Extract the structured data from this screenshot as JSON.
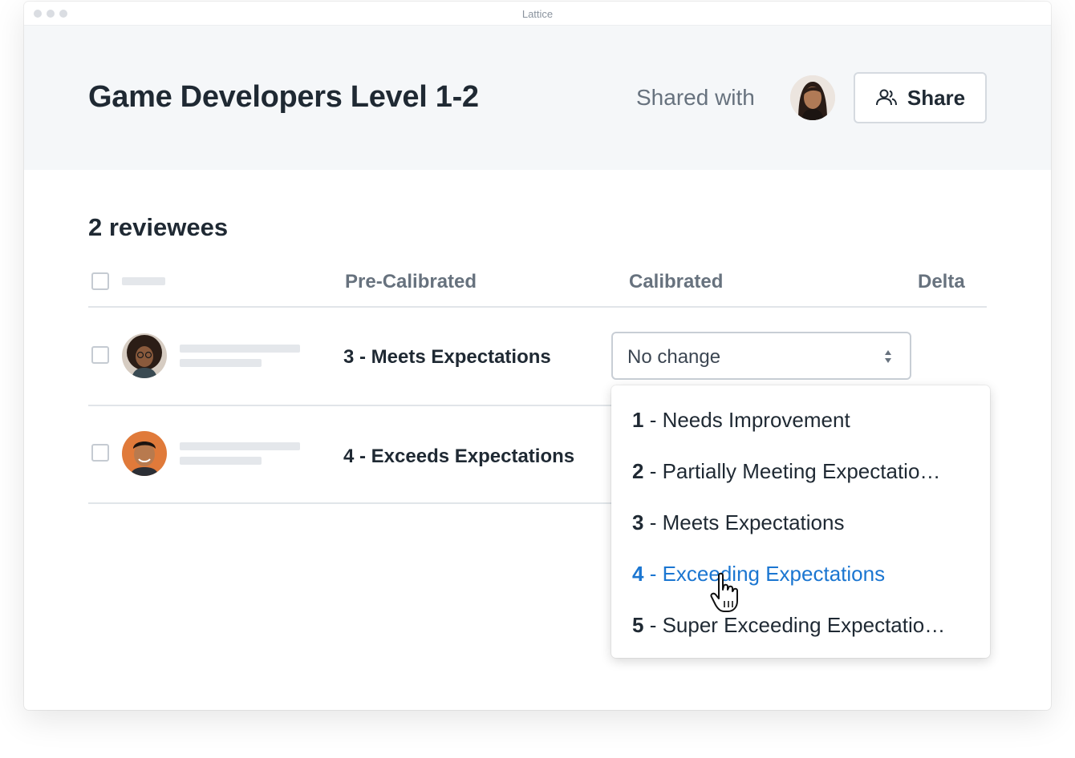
{
  "window": {
    "title": "Lattice"
  },
  "header": {
    "title": "Game Developers Level 1-2",
    "shared_with_label": "Shared with",
    "share_button_label": "Share"
  },
  "section": {
    "title": "2 reviewees"
  },
  "table": {
    "columns": [
      "Pre-Calibrated",
      "Calibrated",
      "Delta"
    ],
    "rows": [
      {
        "pre_calibrated": "3 - Meets Expectations",
        "calibrated": "No change"
      },
      {
        "pre_calibrated": "4 - Exceeds Expectations"
      }
    ]
  },
  "dropdown": {
    "options": [
      {
        "number": "1",
        "label": " - Needs Improvement",
        "active": false
      },
      {
        "number": "2",
        "label": " - Partially Meeting Expectatio…",
        "active": false
      },
      {
        "number": "3",
        "label": " - Meets Expectations",
        "active": false
      },
      {
        "number": "4",
        "label": " - Exceeding Expectations",
        "active": true
      },
      {
        "number": "5",
        "label": " - Super Exceeding Expectatio…",
        "active": false
      }
    ]
  },
  "colors": {
    "accent": "#1b76d1",
    "header_bg": "#f5f7f9",
    "text_primary": "#1f2933",
    "text_secondary": "#67727e"
  },
  "icons": {
    "share": "people-icon",
    "select": "sort-arrows-icon",
    "cursor": "hand-pointer-icon"
  }
}
